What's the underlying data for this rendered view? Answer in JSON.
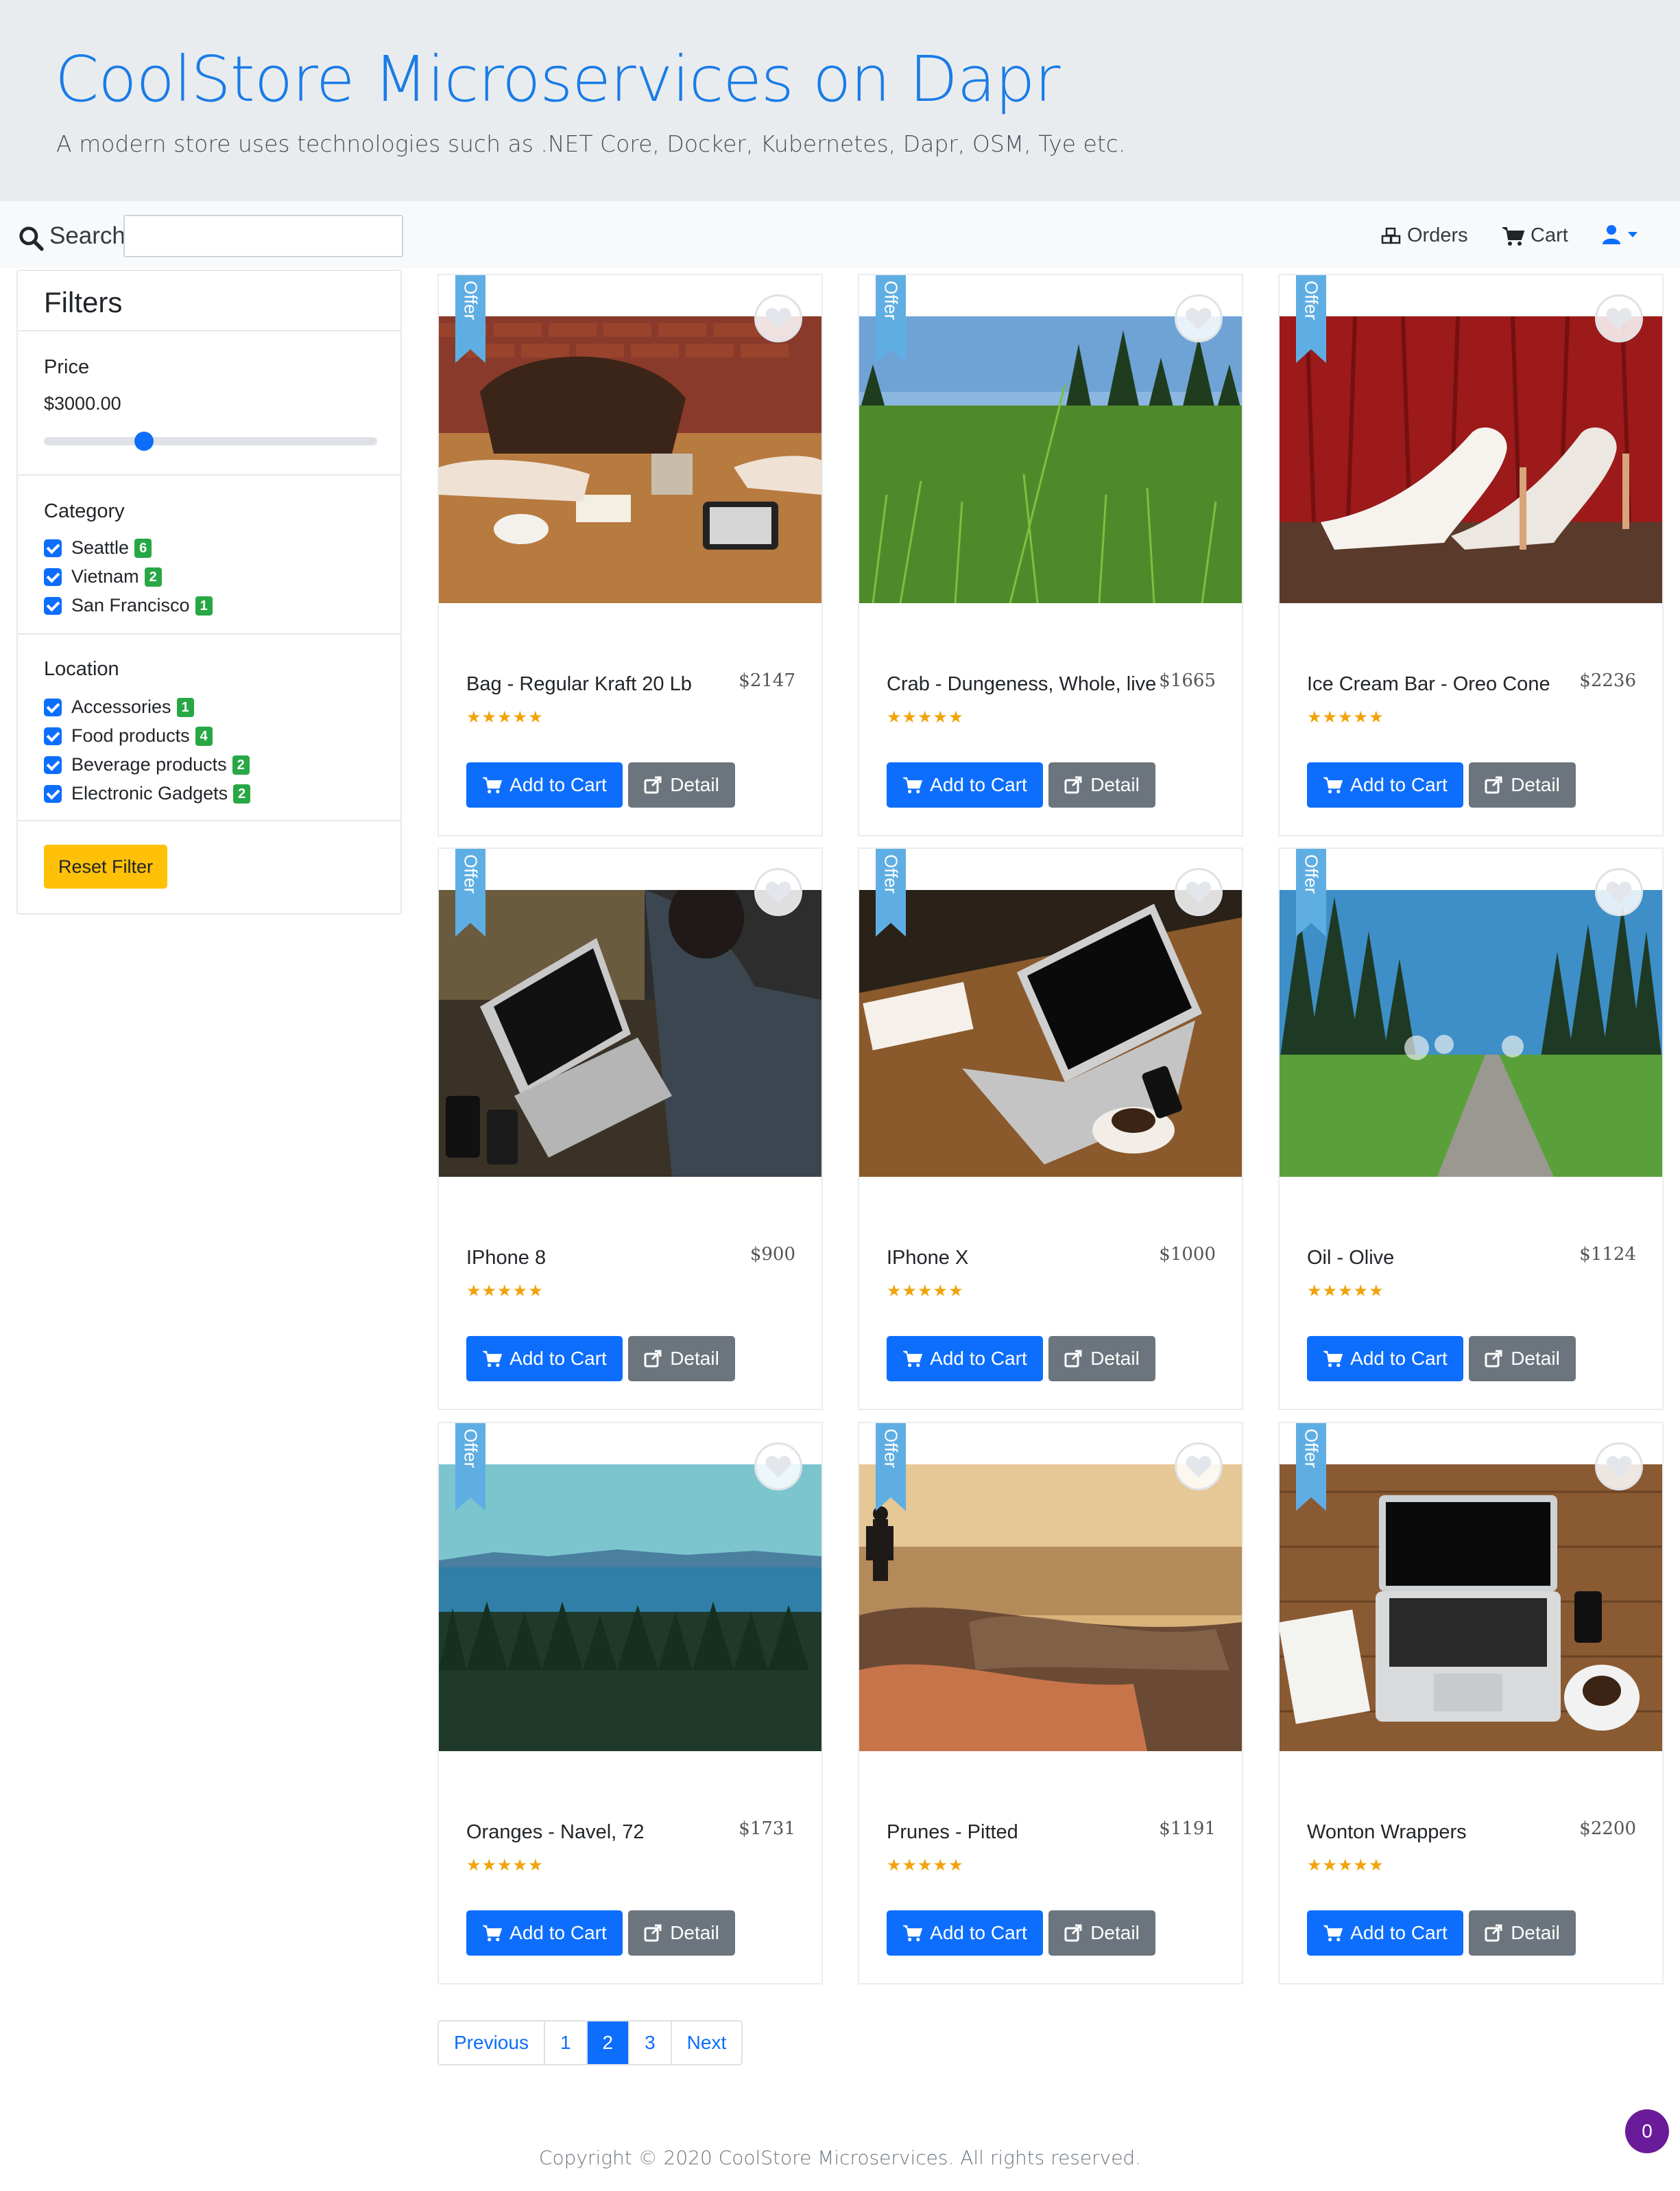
{
  "header": {
    "title": "CoolStore Microservices on Dapr",
    "subtitle": "A modern store uses technologies such as .NET Core, Docker, Kubernetes, Dapr, OSM, Tye etc."
  },
  "navbar": {
    "search_label": "Search",
    "search_value": "",
    "orders_label": "Orders",
    "cart_label": "Cart",
    "user_icon": "user-icon"
  },
  "filters": {
    "title": "Filters",
    "price_heading": "Price",
    "price_value": "$3000.00",
    "price_slider_fraction": 0.3,
    "category_heading": "Category",
    "categories": [
      {
        "label": "Seattle",
        "count": "6"
      },
      {
        "label": "Vietnam",
        "count": "2"
      },
      {
        "label": "San Francisco",
        "count": "1"
      }
    ],
    "location_heading": "Location",
    "locations": [
      {
        "label": "Accessories",
        "count": "1"
      },
      {
        "label": "Food products",
        "count": "4"
      },
      {
        "label": "Beverage products",
        "count": "2"
      },
      {
        "label": "Electronic Gadgets",
        "count": "2"
      }
    ],
    "reset_label": "Reset Filter"
  },
  "product_common": {
    "offer_label": "Offer",
    "rating_stars": "★★★★★",
    "add_to_cart_label": "Add to Cart",
    "detail_label": "Detail"
  },
  "products": [
    {
      "name": "Bag - Regular Kraft 20 Lb",
      "price": "$2147",
      "image": "cafe-table-photo"
    },
    {
      "name": "Crab - Dungeness, Whole, live",
      "price": "$1665",
      "image": "grass-field-photo"
    },
    {
      "name": "Ice Cream Bar - Oreo Cone",
      "price": "$2236",
      "image": "white-heels-photo"
    },
    {
      "name": "IPhone 8",
      "price": "$900",
      "image": "person-laptop-photo"
    },
    {
      "name": "IPhone X",
      "price": "$1000",
      "image": "laptop-desk-photo"
    },
    {
      "name": "Oil - Olive",
      "price": "$1124",
      "image": "forest-path-photo"
    },
    {
      "name": "Oranges - Navel, 72",
      "price": "$1731",
      "image": "forest-lake-photo"
    },
    {
      "name": "Prunes - Pitted",
      "price": "$1191",
      "image": "sunset-beach-photo"
    },
    {
      "name": "Wonton Wrappers",
      "price": "$2200",
      "image": "laptop-topdown-photo"
    }
  ],
  "pagination": {
    "previous": "Previous",
    "pages": [
      "1",
      "2",
      "3"
    ],
    "active": "2",
    "next": "Next"
  },
  "footer": "Copyright © 2020 CoolStore Microservices. All rights reserved.",
  "floating_badge": "0",
  "colors": {
    "primary": "#0d6efd",
    "success": "#28a745",
    "warning": "#ffc107",
    "secondary": "#6c757d",
    "ribbon": "#5faee3"
  }
}
